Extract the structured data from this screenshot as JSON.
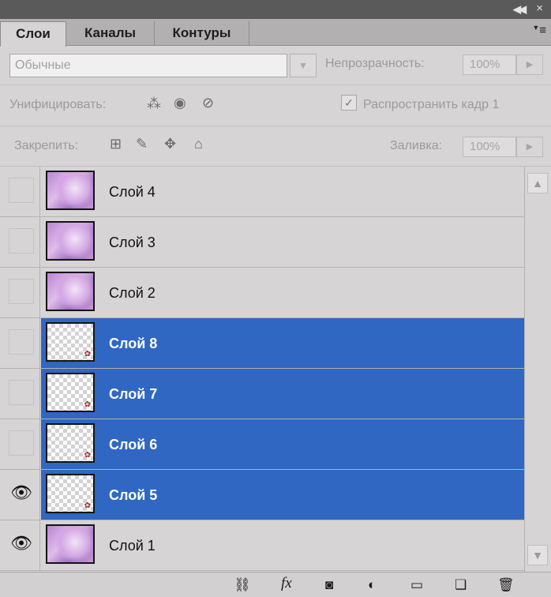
{
  "tabs": [
    {
      "label": "Слои",
      "active": true
    },
    {
      "label": "Каналы",
      "active": false
    },
    {
      "label": "Контуры",
      "active": false
    }
  ],
  "options": {
    "blend_mode": "Обычные",
    "opacity_label": "Непрозрачность:",
    "opacity_value": "100%",
    "unify_label": "Унифицировать:",
    "propagate_label": "Распространить кадр 1",
    "propagate_checked": true,
    "lock_label": "Закрепить:",
    "fill_label": "Заливка:",
    "fill_value": "100%"
  },
  "layers": [
    {
      "name": "Слой 4",
      "visible": false,
      "selected": false,
      "thumb": "image"
    },
    {
      "name": "Слой 3",
      "visible": false,
      "selected": false,
      "thumb": "image"
    },
    {
      "name": "Слой 2",
      "visible": false,
      "selected": false,
      "thumb": "image"
    },
    {
      "name": "Слой 8",
      "visible": false,
      "selected": true,
      "thumb": "transparent"
    },
    {
      "name": "Слой 7",
      "visible": false,
      "selected": true,
      "thumb": "transparent"
    },
    {
      "name": "Слой 6",
      "visible": false,
      "selected": true,
      "thumb": "transparent"
    },
    {
      "name": "Слой 5",
      "visible": true,
      "selected": true,
      "thumb": "transparent"
    },
    {
      "name": "Слой 1",
      "visible": true,
      "selected": false,
      "thumb": "image"
    }
  ],
  "colors": {
    "selection": "#2f67c2",
    "panel": "#d6d4d4",
    "titlebar": "#5a5a5a"
  }
}
